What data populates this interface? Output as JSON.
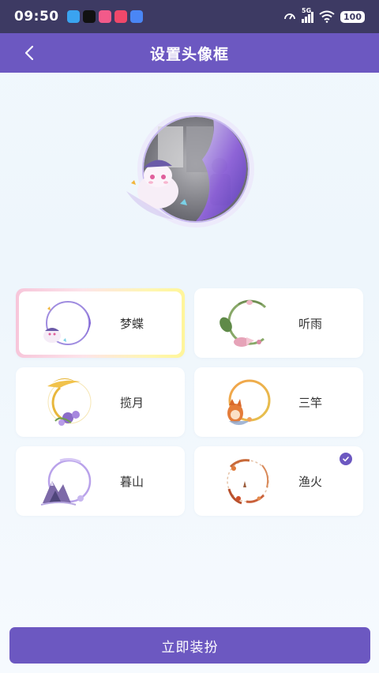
{
  "status_bar": {
    "time": "09:50",
    "network": "5G",
    "battery": "100",
    "notification_icons": [
      "cloud-icon",
      "tiktok-icon",
      "app-icon",
      "video-icon",
      "files-icon"
    ]
  },
  "header": {
    "title": "设置头像框",
    "back_icon": "chevron-left-icon"
  },
  "frames": [
    {
      "name": "梦蝶",
      "selected": true,
      "checked": false
    },
    {
      "name": "听雨",
      "selected": false,
      "checked": false
    },
    {
      "name": "揽月",
      "selected": false,
      "checked": false
    },
    {
      "name": "三竿",
      "selected": false,
      "checked": false
    },
    {
      "name": "暮山",
      "selected": false,
      "checked": false
    },
    {
      "name": "渔火",
      "selected": false,
      "checked": true
    }
  ],
  "apply_button": {
    "label": "立即装扮"
  },
  "colors": {
    "status_bar": "#3d3a63",
    "primary": "#6c58c1",
    "background": "#eef6fc"
  }
}
